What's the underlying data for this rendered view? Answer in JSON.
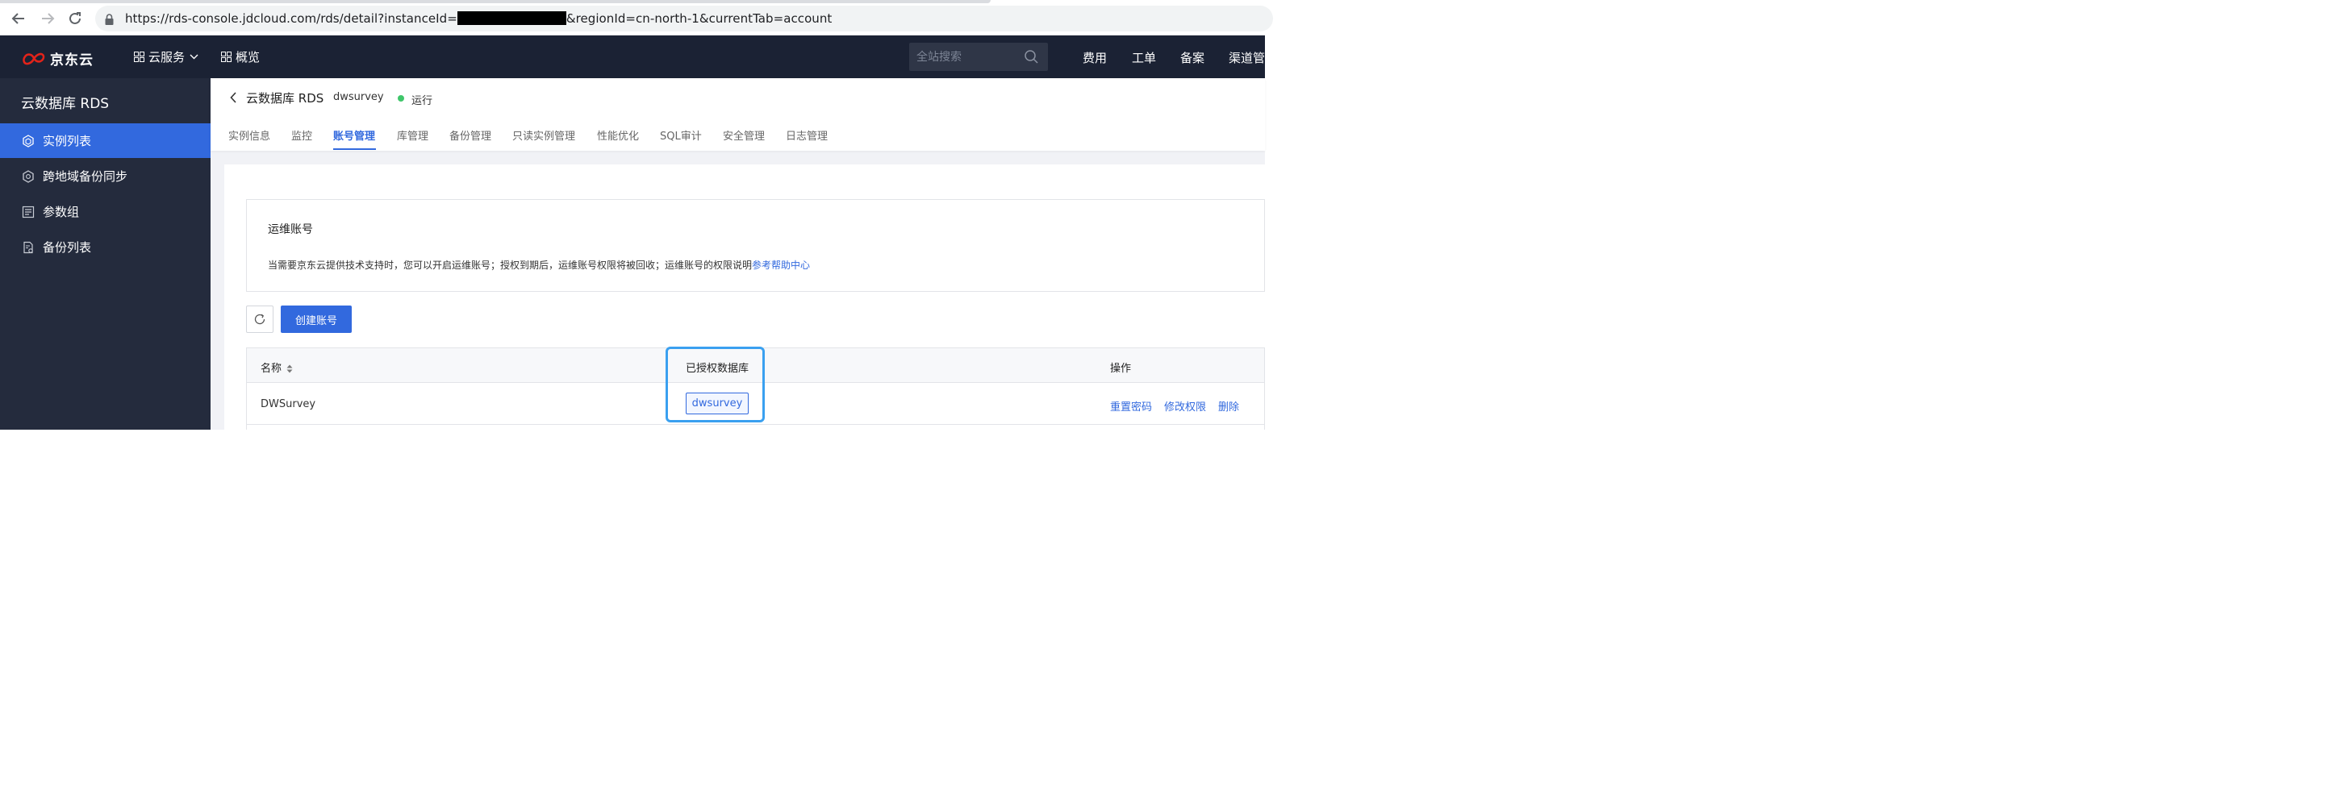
{
  "browser": {
    "url_prefix": "https://rds-console.jdcloud.com/rds/detail?instanceId=",
    "url_suffix": "&regionId=cn-north-1&currentTab=account"
  },
  "topnav": {
    "logo_text": "京东云",
    "cloud_services": "云服务",
    "overview": "概览",
    "search_placeholder": "全站搜索",
    "links": [
      "费用",
      "工单",
      "备案",
      "渠道管"
    ]
  },
  "sidebar": {
    "title": "云数据库 RDS",
    "items": [
      {
        "label": "实例列表",
        "icon": "hexagon-icon",
        "active": true
      },
      {
        "label": "跨地域备份同步",
        "icon": "hexagon-sync-icon",
        "active": false
      },
      {
        "label": "参数组",
        "icon": "list-doc-icon",
        "active": false
      },
      {
        "label": "备份列表",
        "icon": "backup-doc-icon",
        "active": false
      }
    ]
  },
  "header": {
    "service_title": "云数据库 RDS",
    "instance_name": "dwsurvey",
    "status": "运行",
    "status_color": "#3fc66a"
  },
  "tabs": [
    "实例信息",
    "监控",
    "账号管理",
    "库管理",
    "备份管理",
    "只读实例管理",
    "性能优化",
    "SQL审计",
    "安全管理",
    "日志管理"
  ],
  "active_tab": "账号管理",
  "ops_account": {
    "title": "运维账号",
    "description": "当需要京东云提供技术支持时，您可以开启运维账号；授权到期后，运维账号权限将被回收；运维账号的权限说明",
    "help_link": "参考帮助中心"
  },
  "toolbar": {
    "create_label": "创建账号"
  },
  "table": {
    "headers": {
      "name": "名称",
      "databases": "已授权数据库",
      "actions": "操作"
    },
    "rows": [
      {
        "name": "DWSurvey",
        "database": "dwsurvey",
        "actions": [
          "重置密码",
          "修改权限",
          "删除"
        ]
      }
    ]
  },
  "colors": {
    "accent": "#3269de",
    "topnav_bg": "#1b2234",
    "sidebar_bg": "#242b3d",
    "highlight": "#3aa0f0"
  }
}
